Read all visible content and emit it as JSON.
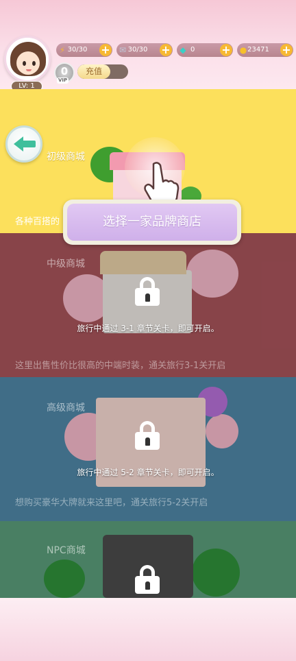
{
  "player": {
    "level": "LV: 1",
    "vip_level": "0",
    "vip_label": "VIP",
    "recharge_label": "充值"
  },
  "resources": [
    {
      "name": "energy",
      "icon": "lightning-icon",
      "value": "30/30"
    },
    {
      "name": "ticket",
      "icon": "ticket-icon",
      "value": "30/30"
    },
    {
      "name": "diamond",
      "icon": "diamond-icon",
      "value": "0"
    },
    {
      "name": "gold",
      "icon": "coin-icon",
      "value": "23471"
    }
  ],
  "shops": [
    {
      "title": "初级商城",
      "description": "各种百搭的",
      "locked": false
    },
    {
      "title": "中级商城",
      "description": "这里出售性价比很高的中端时装，通关旅行3-1关开启",
      "locked": true,
      "unlock_text": "旅行中通过  3-1   章节关卡，即可开启。"
    },
    {
      "title": "高级商城",
      "description": "想购买豪华大牌就来这里吧，通关旅行5-2关开启",
      "locked": true,
      "unlock_text": "旅行中通过  5-2   章节关卡，即可开启。"
    },
    {
      "title": "NPC商城",
      "locked": true
    }
  ],
  "select_prompt": "选择一家品牌商店",
  "colors": {
    "shop1": "#fce05c",
    "shop2": "#a7535a",
    "shop3": "#4f86a5",
    "shop4": "#5a9c79",
    "accent": "#3fbf9c"
  }
}
